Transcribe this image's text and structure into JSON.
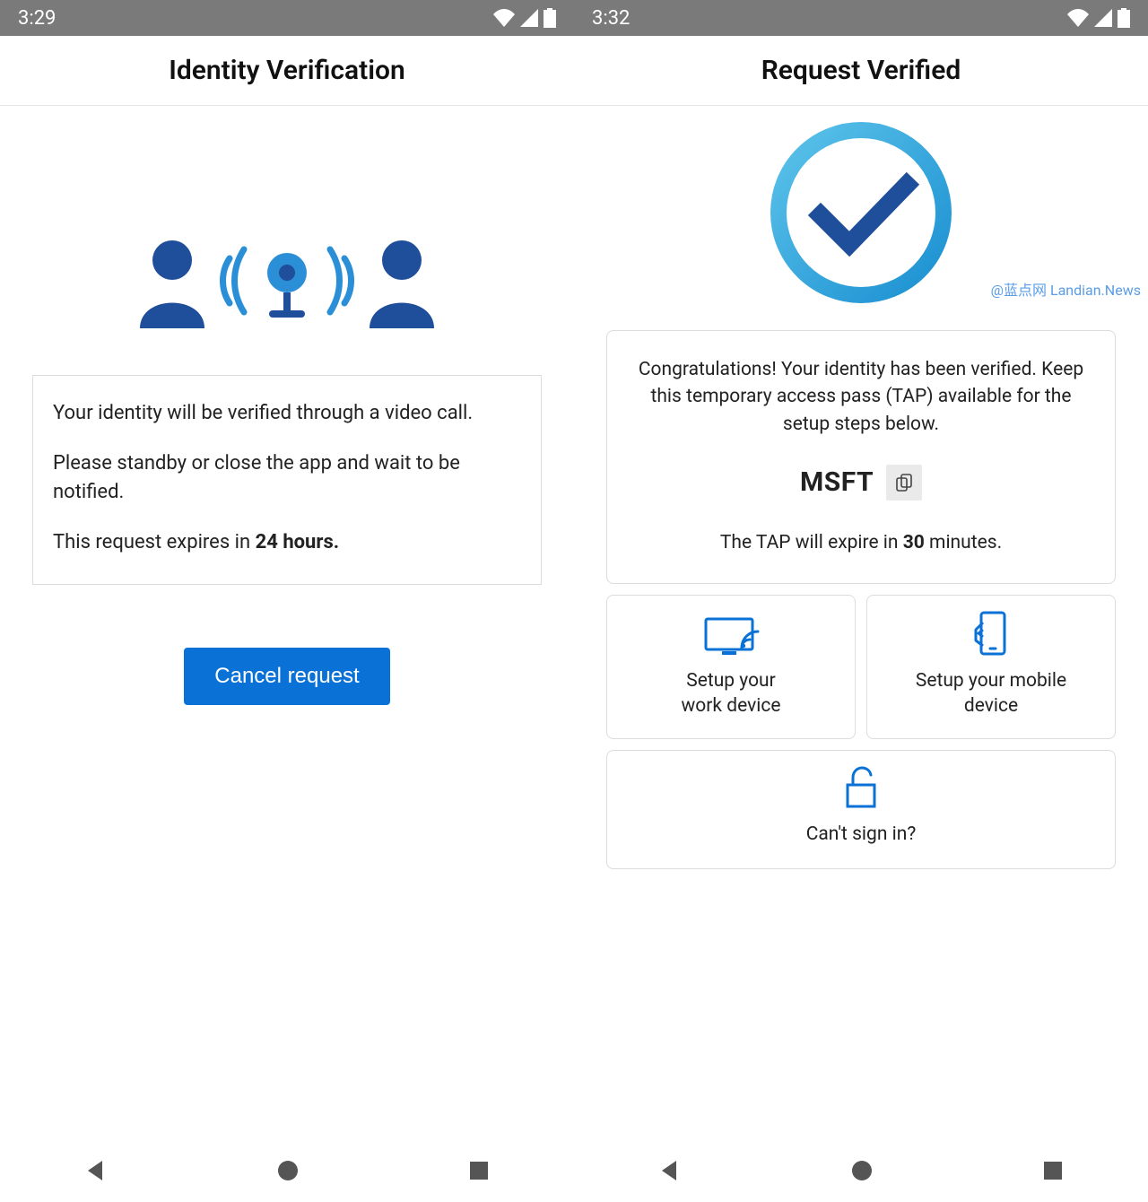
{
  "left": {
    "status": {
      "time": "3:29"
    },
    "header": {
      "title": "Identity Verification"
    },
    "info": {
      "line1": "Your identity will be verified through a video call.",
      "line2": "Please standby or close the app and wait to be notified.",
      "line3_pre": "This request expires in ",
      "line3_bold": "24 hours."
    },
    "cancel_label": "Cancel request",
    "icons": {
      "person_left": "person-icon",
      "signal": "signal-waves-icon",
      "webcam": "webcam-icon",
      "person_right": "person-icon"
    }
  },
  "right": {
    "status": {
      "time": "3:32"
    },
    "header": {
      "title": "Request Verified"
    },
    "watermark": "@蓝点网 Landian.News",
    "card": {
      "congrats": "Congratulations! Your identity has been verified. Keep this temporary access pass (TAP) available for the setup steps below.",
      "tap_code": "MSFT",
      "expire_pre": "The TAP will expire in ",
      "expire_bold": "30",
      "expire_post": " minutes."
    },
    "tiles": {
      "work": {
        "line1": "Setup your",
        "line2": "work device"
      },
      "mobile": {
        "line1": "Setup your mobile",
        "line2": "device"
      },
      "signin": {
        "label": "Can't sign in?"
      }
    },
    "icons": {
      "check": "checkmark-circle-icon",
      "copy": "copy-icon",
      "monitor": "monitor-cast-icon",
      "phone": "phone-hand-icon",
      "lock": "unlock-icon"
    }
  },
  "nav": {
    "back": "nav-back-icon",
    "home": "nav-home-icon",
    "recent": "nav-recent-icon"
  },
  "status_icons": {
    "wifi": "wifi-icon",
    "signal": "cell-signal-icon",
    "battery": "battery-icon"
  },
  "colors": {
    "primary": "#0a72d6",
    "dark_blue": "#1f4e9b",
    "light_blue": "#4db3e8"
  }
}
